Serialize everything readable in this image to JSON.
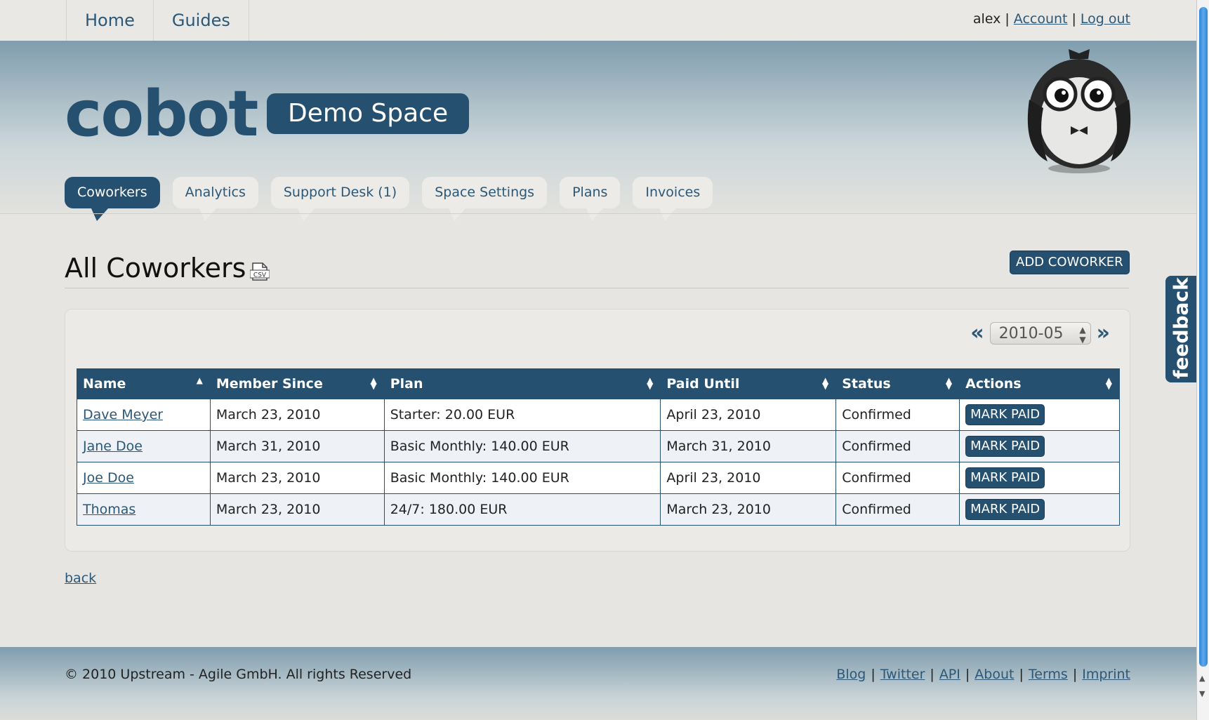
{
  "topnav": {
    "items": [
      "Home",
      "Guides"
    ]
  },
  "user": {
    "name": "alex",
    "sep": "|",
    "account": "Account",
    "logout": "Log out"
  },
  "brand": {
    "logo": "cobot",
    "space_name": "Demo Space"
  },
  "tabs": [
    "Coworkers",
    "Analytics",
    "Support Desk (1)",
    "Space Settings",
    "Plans",
    "Invoices"
  ],
  "active_tab": "Coworkers",
  "page": {
    "title": "All Coworkers",
    "csv_icon_label": "CSV",
    "add_button": "ADD COWORKER"
  },
  "month_nav": {
    "prev": "«",
    "value": "2010-05",
    "next": "»"
  },
  "table": {
    "headers": [
      "Name",
      "Member Since",
      "Plan",
      "Paid Until",
      "Status",
      "Actions"
    ],
    "rows": [
      {
        "name": "Dave Meyer",
        "member_since": "March 23, 2010",
        "plan": "Starter: 20.00 EUR",
        "paid_until": "April 23, 2010",
        "status": "Confirmed",
        "action": "MARK PAID"
      },
      {
        "name": "Jane Doe",
        "member_since": "March 31, 2010",
        "plan": "Basic Monthly: 140.00 EUR",
        "paid_until": "March 31, 2010",
        "status": "Confirmed",
        "action": "MARK PAID"
      },
      {
        "name": "Joe Doe",
        "member_since": "March 23, 2010",
        "plan": "Basic Monthly: 140.00 EUR",
        "paid_until": "April 23, 2010",
        "status": "Confirmed",
        "action": "MARK PAID"
      },
      {
        "name": "Thomas",
        "member_since": "March 23, 2010",
        "plan": "24/7: 180.00 EUR",
        "paid_until": "March 23, 2010",
        "status": "Confirmed",
        "action": "MARK PAID"
      }
    ]
  },
  "back_link": "back",
  "footer": {
    "copyright": "© 2010 Upstream - Agile GmbH. All rights Reserved",
    "links": [
      "Blog",
      "Twitter",
      "API",
      "About",
      "Terms",
      "Imprint"
    ]
  },
  "feedback": "feedback",
  "colors": {
    "brand": "#26506f",
    "link": "#2b5878",
    "page_bg": "#e6e5e1"
  }
}
